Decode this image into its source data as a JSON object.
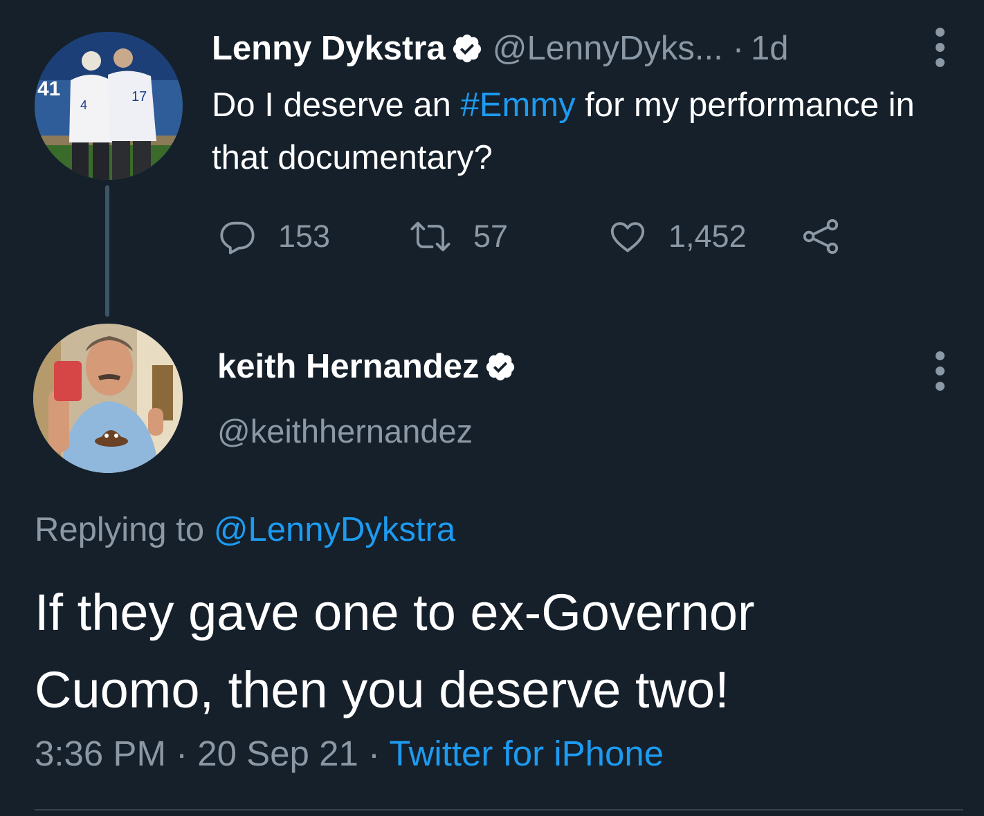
{
  "parent_tweet": {
    "display_name": "Lenny Dykstra",
    "handle": "@LennyDyks...",
    "separator": "·",
    "time": "1d",
    "text_before": "Do I deserve an ",
    "hashtag": "#Emmy",
    "text_after": " for my performance in that documentary?",
    "replies": "153",
    "retweets": "57",
    "likes": "1,452"
  },
  "focus_tweet": {
    "display_name": "keith Hernandez",
    "handle": "@keithhernandez",
    "replying_label": "Replying to ",
    "replying_handle": "@LennyDykstra",
    "text": "If they gave one to ex-Governor Cuomo, then you deserve two!",
    "time": "3:36 PM",
    "separator": "·",
    "date": "20 Sep 21",
    "separator2": "·",
    "source": "Twitter for iPhone"
  },
  "colors": {
    "background": "#15202b",
    "accent": "#1d9bf0",
    "secondary_text": "#8b98a5"
  },
  "icons": {
    "reply": "reply-icon",
    "retweet": "retweet-icon",
    "like": "heart-icon",
    "share": "share-icon",
    "verified": "verified-badge-icon",
    "more": "more-options-icon"
  }
}
